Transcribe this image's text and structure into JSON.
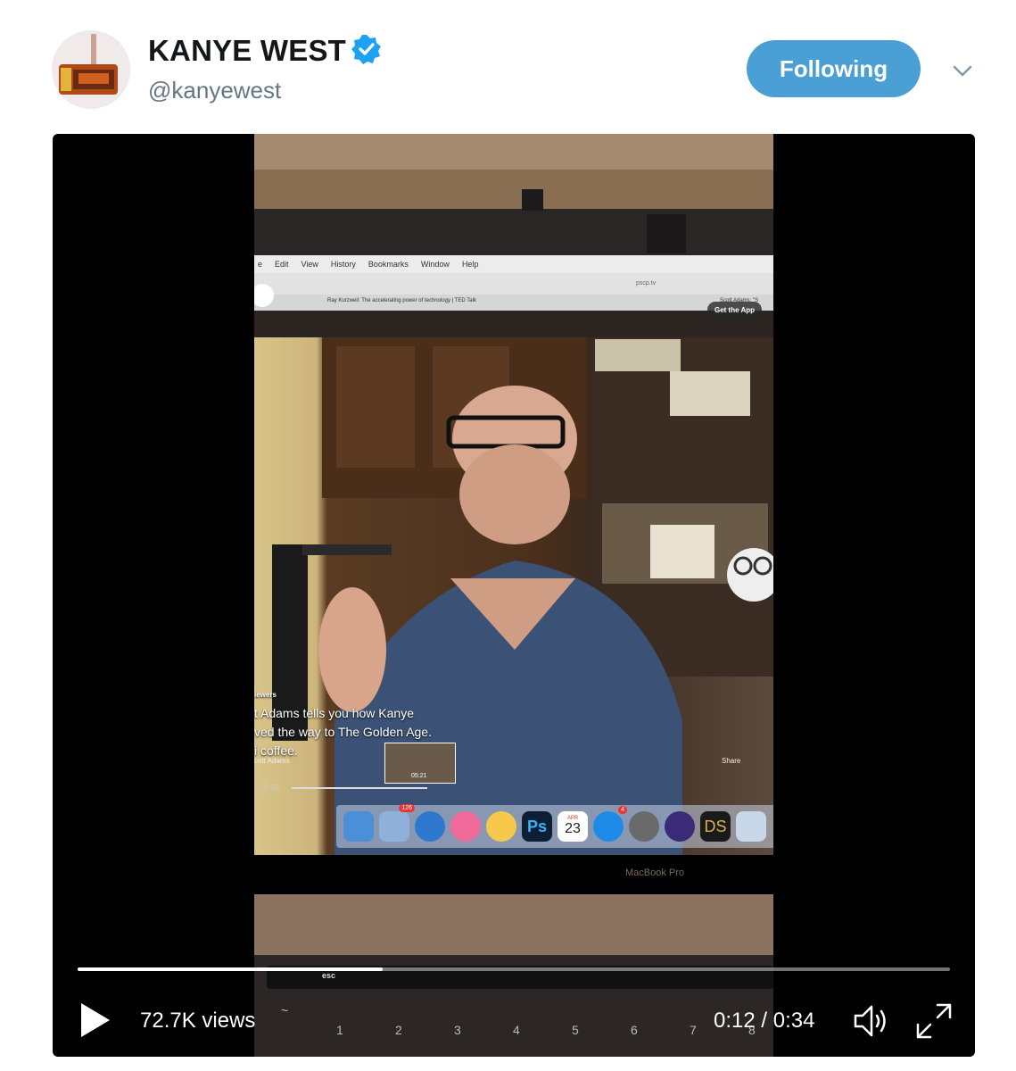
{
  "tweet": {
    "author_name": "KANYE WEST",
    "handle": "@kanyewest",
    "verified_icon": "verified-badge-icon",
    "follow_label": "Following",
    "menu_icon": "chevron-down-icon"
  },
  "video": {
    "views": "72.7K views",
    "time": "0:12 / 0:34",
    "progress": 0.35,
    "play_icon": "play-icon",
    "volume_icon": "volume-icon",
    "fullscreen_icon": "fullscreen-icon",
    "content": {
      "menu_items": [
        "e",
        "Edit",
        "View",
        "History",
        "Bookmarks",
        "Window",
        "Help"
      ],
      "url": "pscp.tv",
      "tab_left": "Ray Kurzweil: The accelerating power of technology | TED Talk",
      "tab_right": "Scott Adams: \"S",
      "get_app": "Get the App",
      "viewers": "iewers",
      "caption_lines": [
        "t Adams tells you how Kanye",
        "ved the way to The Golden Age.",
        "i coffee."
      ],
      "broadcaster": "cott Adams",
      "share": "Share",
      "elapsed": "05:36",
      "thumb_time": "05:21",
      "calendar_month": "APR",
      "calendar_day": "23",
      "notif_count": "126",
      "appstore_count": "4",
      "ps_label": "Ps",
      "ds_label": "DS",
      "macbook_label": "MacBook Pro",
      "esc_key": "esc",
      "keys": [
        "~",
        "1",
        "2",
        "3",
        "4",
        "5",
        "6",
        "7",
        "8"
      ],
      "key_symbols": [
        "",
        "!",
        "@",
        "#",
        "$",
        "%",
        "^",
        "&",
        "*"
      ]
    }
  },
  "colors": {
    "follow_bg": "#4a9fd5",
    "verified": "#1da1f2",
    "handle_text": "#657786",
    "name_text": "#14171a"
  }
}
